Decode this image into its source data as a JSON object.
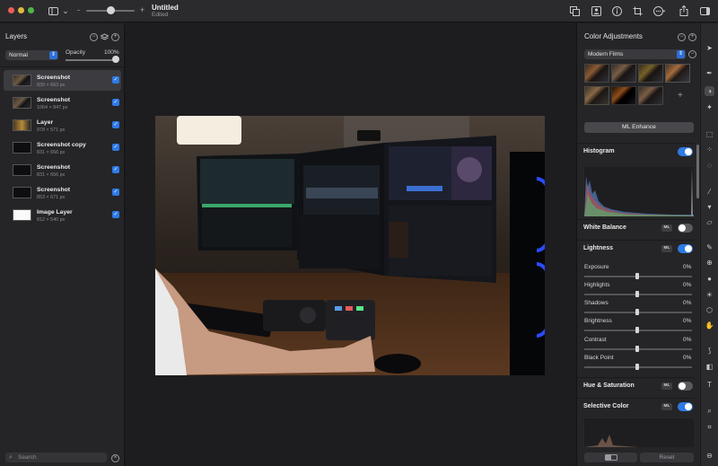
{
  "window": {
    "title": "Untitled",
    "subtitle": "Edited"
  },
  "layers_panel": {
    "title": "Layers",
    "blend_mode": "Normal",
    "opacity_label": "Opacity",
    "opacity_value": "100%",
    "opacity_level": 1.0,
    "layers": [
      {
        "name": "Screenshot",
        "size": "839 × 663 px",
        "visible": true,
        "selected": true
      },
      {
        "name": "Screenshot",
        "size": "1064 × 847 px",
        "visible": true,
        "selected": false
      },
      {
        "name": "Layer",
        "size": "978 × 571 px",
        "visible": true,
        "selected": false
      },
      {
        "name": "Screenshot copy",
        "size": "831 × 656 px",
        "visible": true,
        "selected": false
      },
      {
        "name": "Screenshot",
        "size": "831 × 656 px",
        "visible": true,
        "selected": false
      },
      {
        "name": "Screenshot",
        "size": "853 × 671 px",
        "visible": true,
        "selected": false
      },
      {
        "name": "Image Layer",
        "size": "812 × 540 px",
        "visible": true,
        "selected": false
      }
    ],
    "search_placeholder": "Search"
  },
  "adjustments_panel": {
    "title": "Color Adjustments",
    "preset": "Modern Films",
    "ml_enhance": "ML Enhance",
    "sections": {
      "histogram": {
        "label": "Histogram",
        "enabled": true
      },
      "white_balance": {
        "label": "White Balance",
        "ml": "ML",
        "enabled": false
      },
      "lightness": {
        "label": "Lightness",
        "ml": "ML",
        "enabled": true
      },
      "hue_saturation": {
        "label": "Hue & Saturation",
        "ml": "ML",
        "enabled": false
      },
      "selective_color": {
        "label": "Selective Color",
        "ml": "ML",
        "enabled": true
      }
    },
    "lightness_sliders": [
      {
        "label": "Exposure",
        "value": "0%"
      },
      {
        "label": "Highlights",
        "value": "0%"
      },
      {
        "label": "Shadows",
        "value": "0%"
      },
      {
        "label": "Brightness",
        "value": "0%"
      },
      {
        "label": "Contrast",
        "value": "0%"
      },
      {
        "label": "Black Point",
        "value": "0%"
      }
    ],
    "reset_label": "Reset"
  },
  "colors": {
    "accent": "#2e7ae6",
    "panel": "#252527",
    "canvas": "#1d1d1f"
  }
}
